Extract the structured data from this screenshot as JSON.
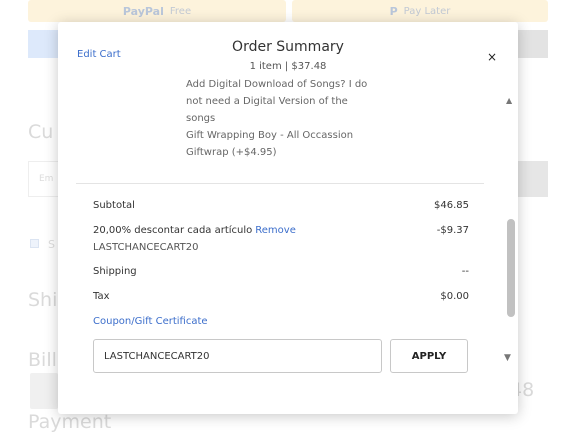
{
  "background": {
    "paypal_label": "PayPal",
    "paypal_sub": "Free",
    "paylater_label": "P",
    "paylater_sub": "Pay Later",
    "customer_heading": "Cu",
    "shipping_heading": "Shi",
    "billing_heading": "Bill",
    "payment_heading": "Payment",
    "email_placeholder": "Em",
    "check_label": "S",
    "amount": "48"
  },
  "modal": {
    "edit_cart": "Edit Cart",
    "title": "Order Summary",
    "subtitle": "1 item | $37.48",
    "close_glyph": "×",
    "item_details": [
      "Add Digital Download of Songs? I do",
      "not need a Digital Version of the",
      "songs",
      "Gift Wrapping Boy - All Occassion",
      "Giftwrap (+$4.95)"
    ],
    "summary": {
      "subtotal_label": "Subtotal",
      "subtotal_value": "$46.85",
      "discount_label": "20,00% descontar cada artículo",
      "discount_remove": "Remove",
      "discount_value": "-$9.37",
      "discount_code": "LASTCHANCECART20",
      "shipping_label": "Shipping",
      "shipping_value": "--",
      "tax_label": "Tax",
      "tax_value": "$0.00",
      "coupon_link": "Coupon/Gift Certificate"
    },
    "coupon_input_value": "LASTCHANCECART20",
    "apply_label": "APPLY"
  },
  "colors": {
    "link": "#3c6ecb",
    "paypal_bg": "#fdf3dc",
    "scrollbar": "#c1c1c1"
  }
}
